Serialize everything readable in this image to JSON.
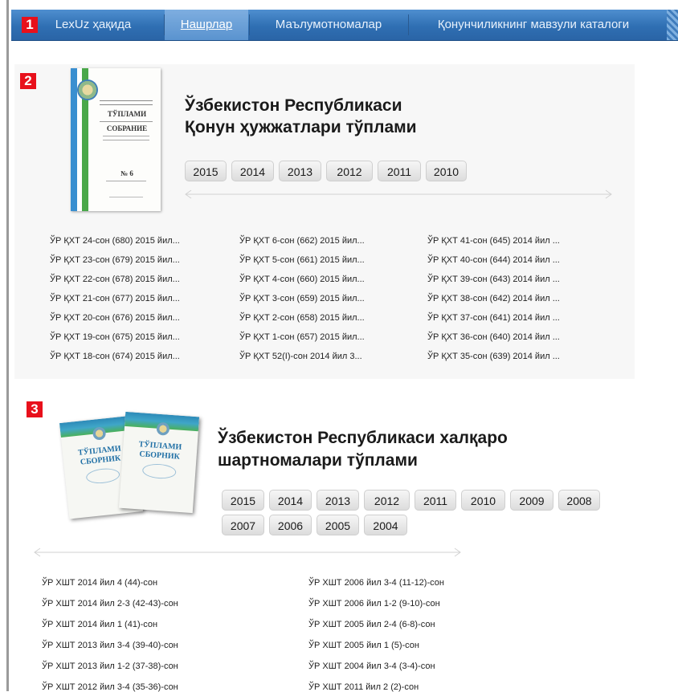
{
  "nav": {
    "marker": "1",
    "items": [
      {
        "label": "LexUz ҳақида",
        "active": false
      },
      {
        "label": "Нашрлар",
        "active": true
      },
      {
        "label": "Маълумотномалар",
        "active": false
      },
      {
        "label": "Қонунчиликнинг мавзули каталоги",
        "active": false
      }
    ]
  },
  "section1": {
    "marker": "2",
    "title_line1": "Ўзбекистон Республикаси",
    "title_line2": "Қонун ҳужжатлари тўплами",
    "cover_lines": [
      "ТЎПЛАМИ",
      "СОБРАНИЕ",
      "№ 6"
    ],
    "years": [
      "2015",
      "2014",
      "2013",
      "2012",
      "2011",
      "2010"
    ],
    "docs_col1": [
      "ЎР ҚХТ 24-сон (680) 2015 йил...",
      "ЎР ҚХТ 23-сон (679) 2015 йил...",
      "ЎР ҚХТ 22-сон (678) 2015 йил...",
      "ЎР ҚХТ 21-сон (677) 2015 йил...",
      "ЎР ҚХТ 20-сон (676) 2015 йил...",
      "ЎР ҚХТ 19-сон (675) 2015 йил...",
      "ЎР ҚХТ 18-сон (674) 2015 йил..."
    ],
    "docs_col2": [
      "ЎР ҚХТ 6-сон (662) 2015 йил...",
      "ЎР ҚХТ 5-сон (661) 2015 йил...",
      "ЎР ҚХТ 4-сон (660) 2015 йил...",
      "ЎР ҚХТ 3-сон (659) 2015 йил...",
      "ЎР ҚХТ 2-сон (658) 2015 йил...",
      "ЎР ҚХТ 1-сон (657) 2015 йил...",
      "ЎР ҚХТ 52(I)-сон 2014 йил 3..."
    ],
    "docs_col3": [
      "ЎР ҚХТ 41-сон (645) 2014 йил ...",
      "ЎР ҚХТ 40-сон (644) 2014 йил ...",
      "ЎР ҚХТ 39-сон (643) 2014 йил ...",
      "ЎР ҚХТ 38-сон (642) 2014 йил ...",
      "ЎР ҚХТ 37-сон (641) 2014 йил ...",
      "ЎР ҚХТ 36-сон (640) 2014 йил ...",
      "ЎР ҚХТ 35-сон (639) 2014 йил ..."
    ]
  },
  "section2": {
    "marker": "3",
    "title_line1": "Ўзбекистон Республикаси халқаро",
    "title_line2": "шартномалари тўплами",
    "book_titles": [
      "ТЎПЛАМИ",
      "СБОРНИК"
    ],
    "years_row1": [
      "2015",
      "2014",
      "2013",
      "2012",
      "2011",
      "2010",
      "2009",
      "2008"
    ],
    "years_row2": [
      "2007",
      "2006",
      "2005",
      "2004"
    ],
    "docs_col1": [
      "ЎР ХШТ 2014 йил 4 (44)-сон",
      "ЎР ХШТ 2014 йил 2-3 (42-43)-сон",
      "ЎР ХШТ 2014 йил 1 (41)-сон",
      "ЎР ХШТ 2013 йил 3-4 (39-40)-сон",
      "ЎР ХШТ 2013 йил 1-2 (37-38)-сон",
      "ЎР ХШТ 2012 йил 3-4 (35-36)-сон"
    ],
    "docs_col2": [
      "ЎР ХШТ 2006 йил 3-4 (11-12)-сон",
      "ЎР ХШТ 2006 йил 1-2 (9-10)-сон",
      "ЎР ХШТ 2005 йил 2-4 (6-8)-сон",
      "ЎР ХШТ 2005 йил 1 (5)-сон",
      "ЎР ХШТ 2004 йил 3-4 (3-4)-сон",
      "ЎР ХШТ 2011 йил 2 (2)-сон"
    ]
  }
}
